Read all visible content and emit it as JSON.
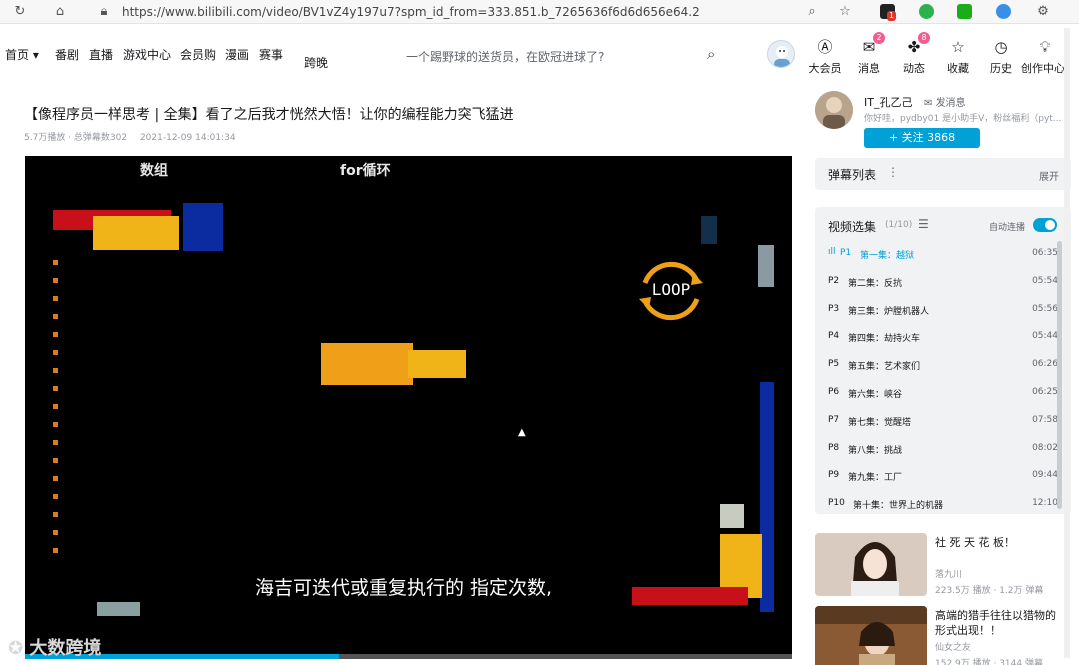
{
  "browser": {
    "url": "https://www.bilibili.com/video/BV1vZ4y197u7?spm_id_from=333.851.b_7265636f6d6d656e64.2",
    "icons": [
      "refresh-icon",
      "home-icon",
      "lock-icon",
      "zoom-icon",
      "favorite-icon",
      "profile-icon",
      "extension-green-icon",
      "extension-wechat-icon",
      "extension-globe-icon",
      "extensions-icon"
    ],
    "ext_badge": "1"
  },
  "header": {
    "nav": [
      "首页",
      "番剧",
      "直播",
      "游戏中心",
      "会员购",
      "漫画",
      "赛事",
      "跨晚"
    ],
    "search_text": "一个踢野球的送货员，在欧冠进球了?",
    "buttons": [
      {
        "label": "大会员",
        "icon": "vip-icon",
        "badge": ""
      },
      {
        "label": "消息",
        "icon": "message-icon",
        "badge": "2"
      },
      {
        "label": "动态",
        "icon": "dynamic-icon",
        "badge": "8"
      },
      {
        "label": "收藏",
        "icon": "star-icon",
        "badge": ""
      },
      {
        "label": "历史",
        "icon": "history-icon",
        "badge": ""
      },
      {
        "label": "创作中心",
        "icon": "creator-icon",
        "badge": ""
      }
    ]
  },
  "video": {
    "title": "【像程序员一样思考 | 全集】看了之后我才恍然大悟！让你的编程能力突飞猛进",
    "plays": "5.7万播放 · 总弹幕数302",
    "date": "2021-12-09 14:01:34",
    "labels": {
      "array": "数组",
      "for_loop": "for循环",
      "loop": "LOOP"
    },
    "subtitle": "海吉可迭代或重复执行的 指定次数,",
    "progress": 0.41,
    "watermark": "大数跨境"
  },
  "uploader": {
    "name": "IT_孔乙己",
    "message": "发消息",
    "desc": "你好哇，pydby01 是小助手V，粉丝福利（pyt...",
    "follow": "+ 关注 3868"
  },
  "danmaku": {
    "title": "弹幕列表",
    "expand": "展开"
  },
  "playlist": {
    "title": "视频选集",
    "count": "(1/10)",
    "autoplay": "自动连播",
    "episodes": [
      {
        "p": "P1",
        "name": "第一集：越狱",
        "dur": "06:35"
      },
      {
        "p": "P2",
        "name": "第二集：反抗",
        "dur": "05:54"
      },
      {
        "p": "P3",
        "name": "第三集：炉膛机器人",
        "dur": "05:56"
      },
      {
        "p": "P4",
        "name": "第四集：劫持火车",
        "dur": "05:44"
      },
      {
        "p": "P5",
        "name": "第五集：艺术家们",
        "dur": "06:26"
      },
      {
        "p": "P6",
        "name": "第六集：峡谷",
        "dur": "06:25"
      },
      {
        "p": "P7",
        "name": "第七集：觉醒塔",
        "dur": "07:58"
      },
      {
        "p": "P8",
        "name": "第八集：挑战",
        "dur": "08:02"
      },
      {
        "p": "P9",
        "name": "第九集：工厂",
        "dur": "09:44"
      },
      {
        "p": "P10",
        "name": "第十集：世界上的机器",
        "dur": "12:10"
      }
    ]
  },
  "recommendations": [
    {
      "title": "社 死 天 花 板！",
      "author": "落九川",
      "stats": "223.5万 播放 · 1.2万 弹幕"
    },
    {
      "title": "高端的猎手往往以猎物的形式出现！！",
      "author": "仙女之友",
      "stats": "152.9万 播放 · 3144 弹幕"
    }
  ],
  "colors": {
    "accent": "#00a1d6",
    "badge": "#f25d8e",
    "blockRed": "#c8101a",
    "blockYellow": "#f0b418",
    "blockBlue": "#0a2ca0",
    "blockOrange": "#f0a018"
  }
}
